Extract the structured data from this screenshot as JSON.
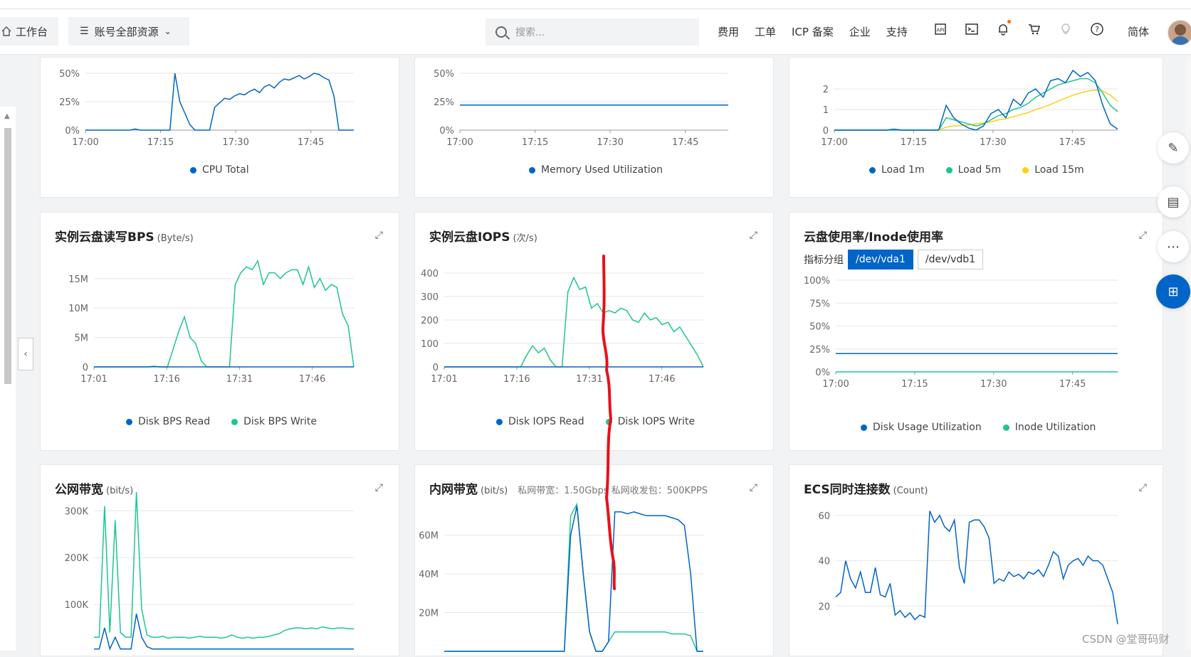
{
  "topbar": {
    "workbench": "工作台",
    "resources": "账号全部资源",
    "search_placeholder": "搜索...",
    "links": [
      "费用",
      "工单",
      "ICP 备案",
      "企业",
      "支持"
    ],
    "icons": [
      "api-icon",
      "terminal-icon",
      "bell-icon",
      "cart-icon",
      "bulb-icon",
      "help-icon"
    ],
    "lang": "简体"
  },
  "colors": {
    "blue": "#0064c8",
    "green": "#1ec593",
    "yellow": "#f8d315",
    "annotation_red": "#e8101a"
  },
  "cards": {
    "cpu": {
      "legend": [
        "CPU Total"
      ]
    },
    "mem": {
      "legend": [
        "Memory Used Utilization"
      ]
    },
    "load": {
      "legend": [
        "Load 1m",
        "Load 5m",
        "Load 15m"
      ]
    },
    "bps": {
      "title": "实例云盘读写BPS",
      "unit": "(Byte/s)",
      "legend": [
        "Disk BPS Read",
        "Disk BPS Write"
      ]
    },
    "iops": {
      "title": "实例云盘IOPS",
      "unit": "(次/s)",
      "legend": [
        "Disk IOPS Read",
        "Disk IOPS Write"
      ]
    },
    "disk": {
      "title": "云盘使用率/Inode使用率",
      "group_label": "指标分组",
      "tabs": [
        "/dev/vda1",
        "/dev/vdb1"
      ],
      "legend": [
        "Disk Usage Utilization",
        "Inode Utilization"
      ]
    },
    "pub": {
      "title": "公网带宽",
      "unit": "(bit/s)"
    },
    "intra": {
      "title": "内网带宽",
      "unit": "(bit/s)",
      "extra": "私网带宽：1.50Gbps 私网收发包：500KPPS"
    },
    "conn": {
      "title": "ECS同时连接数",
      "unit": "(Count)"
    }
  },
  "chart_data": [
    {
      "type": "line",
      "x_ticks": [
        "17:00",
        "17:15",
        "17:30",
        "17:45"
      ],
      "y_ticks": [
        "0%",
        "25%",
        "50%"
      ],
      "series": [
        {
          "name": "CPU Total",
          "values": [
            0,
            0,
            0,
            0,
            0,
            0,
            0,
            0,
            0,
            0,
            1,
            0,
            0,
            0,
            0,
            0,
            0,
            0,
            50,
            25,
            15,
            5,
            0,
            0,
            0,
            0,
            20,
            24,
            28,
            27,
            30,
            32,
            31,
            34,
            36,
            33,
            38,
            40,
            37,
            42,
            45,
            44,
            46,
            48,
            45,
            47,
            50,
            49,
            46,
            44,
            30,
            0,
            0,
            0,
            0
          ]
        }
      ]
    },
    {
      "type": "line",
      "x_ticks": [
        "17:00",
        "17:15",
        "17:30",
        "17:45"
      ],
      "y_ticks": [
        "0%",
        "25%",
        "50%"
      ],
      "series": [
        {
          "name": "Memory Used Utilization",
          "values": [
            22,
            22,
            22,
            22,
            22,
            22,
            22,
            22,
            22,
            22
          ]
        }
      ]
    },
    {
      "type": "line",
      "x_ticks": [
        "17:00",
        "17:15",
        "17:30",
        "17:45"
      ],
      "y_ticks": [
        "0",
        "1",
        "2"
      ],
      "series": [
        {
          "name": "Load 1m",
          "values": [
            0,
            0,
            0,
            0,
            0,
            0,
            0,
            0,
            0.05,
            0,
            0,
            0,
            0,
            0,
            0,
            1.2,
            0.6,
            0.3,
            0.1,
            0,
            0.2,
            0.8,
            1.0,
            0.6,
            1.5,
            1.2,
            1.8,
            2.0,
            1.6,
            2.4,
            2.5,
            2.3,
            2.9,
            2.6,
            2.8,
            2.4,
            1.2,
            0.3,
            0.05
          ]
        },
        {
          "name": "Load 5m",
          "values": [
            0,
            0,
            0,
            0,
            0,
            0,
            0,
            0,
            0,
            0,
            0,
            0,
            0,
            0,
            0,
            0.6,
            0.5,
            0.4,
            0.3,
            0.2,
            0.3,
            0.5,
            0.7,
            0.8,
            1.0,
            1.1,
            1.3,
            1.6,
            1.8,
            2.0,
            2.2,
            2.3,
            2.4,
            2.5,
            2.5,
            2.3,
            1.8,
            1.2,
            0.9
          ]
        },
        {
          "name": "Load 15m",
          "values": [
            0,
            0,
            0,
            0,
            0,
            0,
            0,
            0,
            0,
            0,
            0,
            0,
            0,
            0,
            0,
            0.15,
            0.2,
            0.22,
            0.25,
            0.3,
            0.35,
            0.4,
            0.5,
            0.55,
            0.65,
            0.75,
            0.85,
            1.0,
            1.1,
            1.25,
            1.4,
            1.55,
            1.7,
            1.8,
            1.9,
            1.95,
            1.9,
            1.7,
            1.4
          ]
        }
      ]
    },
    {
      "type": "line",
      "x_ticks": [
        "17:01",
        "17:16",
        "17:31",
        "17:46"
      ],
      "y_ticks": [
        "0",
        "5M",
        "10M",
        "15M"
      ],
      "series": [
        {
          "name": "Disk BPS Read",
          "values": [
            0,
            0,
            0,
            0,
            0,
            0,
            0,
            0,
            0,
            0.1,
            0,
            0,
            0,
            0,
            0,
            0,
            0,
            0,
            0,
            0,
            0,
            0,
            0,
            0,
            0,
            0,
            0,
            0,
            0,
            0,
            0,
            0,
            0,
            0,
            0,
            0,
            0,
            0,
            0,
            0
          ]
        },
        {
          "name": "Disk BPS Write",
          "values": [
            0,
            0,
            0,
            0,
            0,
            0,
            0,
            0,
            0,
            0,
            0,
            0,
            0,
            0,
            3,
            6,
            8.5,
            5,
            4,
            1,
            0,
            0,
            0,
            0,
            0,
            14,
            16,
            17,
            16.5,
            18,
            14,
            16,
            16,
            15,
            16,
            16.5,
            16.5,
            14,
            17,
            13.5,
            15,
            13,
            14,
            13.5,
            9,
            7,
            0
          ]
        }
      ]
    },
    {
      "type": "line",
      "x_ticks": [
        "17:01",
        "17:16",
        "17:31",
        "17:46"
      ],
      "y_ticks": [
        "0",
        "100",
        "200",
        "300",
        "400"
      ],
      "series": [
        {
          "name": "Disk IOPS Read",
          "values": [
            0,
            0,
            0,
            0,
            0,
            0,
            0,
            0,
            0,
            0,
            0,
            0,
            0,
            0,
            0,
            0,
            0,
            0,
            0,
            0,
            0,
            0,
            0,
            0,
            0,
            0,
            0,
            0,
            0,
            0,
            0,
            0,
            0,
            0
          ]
        },
        {
          "name": "Disk IOPS Write",
          "values": [
            0,
            0,
            0,
            0,
            0,
            0,
            0,
            0,
            0,
            0,
            0,
            0,
            0,
            0,
            50,
            90,
            60,
            80,
            30,
            0,
            0,
            320,
            380,
            330,
            340,
            250,
            270,
            230,
            240,
            230,
            250,
            240,
            200,
            190,
            230,
            200,
            210,
            180,
            190,
            150,
            170,
            130,
            90,
            50,
            0
          ]
        }
      ]
    },
    {
      "type": "line",
      "x_ticks": [
        "17:00",
        "17:15",
        "17:30",
        "17:45"
      ],
      "y_ticks": [
        "0%",
        "25%",
        "50%",
        "75%",
        "100%"
      ],
      "series": [
        {
          "name": "Disk Usage Utilization",
          "values": [
            20,
            20,
            20,
            20,
            20,
            20,
            20,
            20,
            20,
            20
          ]
        },
        {
          "name": "Inode Utilization",
          "values": [
            0,
            0,
            0,
            0,
            0,
            0,
            0,
            0,
            0,
            0
          ]
        }
      ]
    },
    {
      "type": "line",
      "y_ticks": [
        "100K",
        "200K",
        "300K"
      ],
      "series": [
        {
          "name": "",
          "values": [
            5,
            5,
            50,
            5,
            30,
            5,
            5,
            5,
            80,
            30,
            10,
            5,
            5,
            5,
            5,
            5,
            5,
            5,
            5,
            5,
            5,
            5,
            5,
            5,
            5,
            5,
            5,
            5,
            5,
            5,
            5,
            5,
            5,
            5,
            5,
            5,
            5,
            5,
            5,
            5,
            5,
            5,
            5,
            5,
            5,
            5,
            5,
            5,
            5,
            5
          ]
        },
        {
          "name": "",
          "values": [
            30,
            30,
            310,
            40,
            280,
            40,
            30,
            30,
            340,
            90,
            35,
            30,
            30,
            32,
            28,
            30,
            30,
            30,
            28,
            30,
            32,
            30,
            30,
            30,
            28,
            30,
            35,
            30,
            28,
            30,
            28,
            30,
            30,
            32,
            35,
            38,
            45,
            48,
            50,
            50,
            48,
            50,
            48,
            52,
            50,
            48,
            50,
            50,
            48,
            48
          ]
        }
      ]
    },
    {
      "type": "line",
      "y_ticks": [
        "20M",
        "40M",
        "60M"
      ],
      "series": [
        {
          "name": "",
          "values": [
            0,
            0,
            0,
            0,
            0,
            0,
            0,
            0,
            0,
            0,
            0,
            0,
            0,
            0,
            0,
            0,
            0,
            0,
            0,
            0,
            60,
            75,
            40,
            10,
            0,
            0,
            5,
            72,
            72,
            71,
            72,
            71,
            70,
            70,
            70,
            70,
            69,
            68,
            65,
            40,
            0,
            0
          ]
        },
        {
          "name": "",
          "values": [
            0,
            0,
            0,
            0,
            0,
            0,
            0,
            0,
            0,
            0,
            0,
            0,
            0,
            0,
            0,
            0,
            0,
            0,
            0,
            0,
            70,
            76,
            40,
            10,
            0,
            0,
            5,
            10,
            10,
            10,
            10,
            10,
            10,
            10,
            10,
            10,
            9,
            9,
            9,
            8,
            0,
            0
          ]
        }
      ]
    },
    {
      "type": "line",
      "y_ticks": [
        "20",
        "40",
        "60"
      ],
      "series": [
        {
          "name": "",
          "values": [
            24,
            26,
            40,
            32,
            28,
            35,
            26,
            26,
            37,
            25,
            24,
            30,
            16,
            18,
            15,
            17,
            14,
            16,
            15,
            62,
            57,
            60,
            55,
            53,
            58,
            37,
            30,
            57,
            58,
            58,
            55,
            50,
            30,
            32,
            31,
            35,
            33,
            34,
            32,
            35,
            34,
            36,
            33,
            38,
            44,
            42,
            32,
            38,
            40,
            41,
            38,
            42,
            40,
            40,
            38,
            32,
            26,
            12
          ]
        }
      ]
    }
  ]
}
